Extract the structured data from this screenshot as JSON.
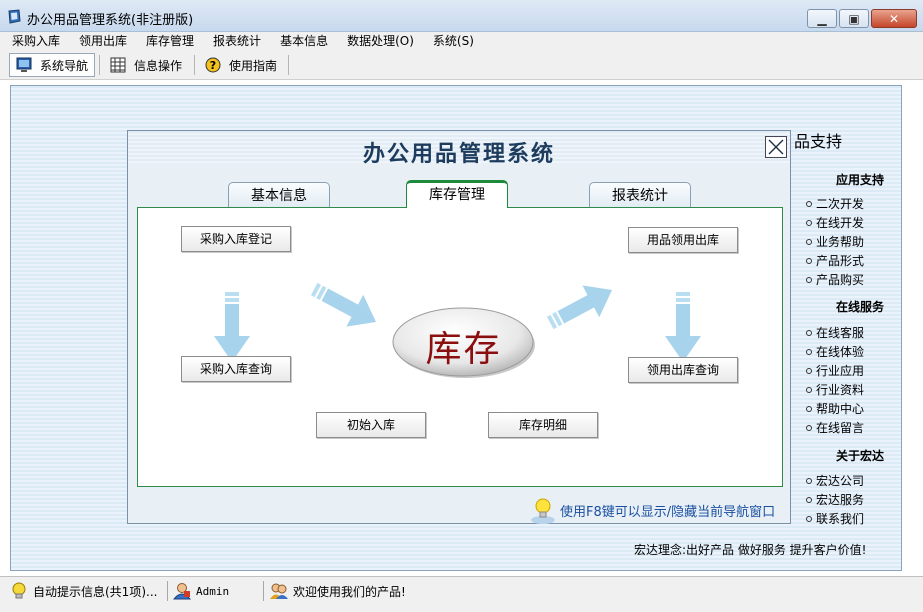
{
  "window": {
    "title": "办公用品管理系统(非注册版)"
  },
  "menu": [
    "采购入库",
    "领用出库",
    "库存管理",
    "报表统计",
    "基本信息",
    "数据处理(O)",
    "系统(S)"
  ],
  "toolbar": {
    "nav": "系统导航",
    "info_op": "信息操作",
    "guide": "使用指南"
  },
  "right_panel": {
    "title_partial": "品支持",
    "sections": [
      {
        "heading": "应用支持",
        "links": [
          "二次开发",
          "在线开发",
          "业务帮助",
          "产品形式",
          "产品购买"
        ]
      },
      {
        "heading": "在线服务",
        "links": [
          "在线客服",
          "在线体验",
          "行业应用",
          "行业资料",
          "帮助中心",
          "在线留言"
        ]
      },
      {
        "heading": "关于宏达",
        "links": [
          "宏达公司",
          "宏达服务",
          "联系我们"
        ]
      }
    ],
    "slogan": "宏达理念:出好产品 做好服务 提升客户价值!"
  },
  "dialog": {
    "title": "办公用品管理系统",
    "tabs": [
      "基本信息",
      "库存管理",
      "报表统计"
    ],
    "active_tab": "库存管理",
    "buttons": {
      "purchase_register": "采购入库登记",
      "purchase_query": "采购入库查询",
      "issue_out": "用品领用出库",
      "issue_query": "领用出库查询",
      "initial_stock": "初始入库",
      "stock_detail": "库存明细"
    },
    "center": "库存",
    "hint": "使用F8键可以显示/隐藏当前导航窗口"
  },
  "status": {
    "tips": "自动提示信息(共1项)...",
    "user": "Admin",
    "welcome": "欢迎使用我们的产品!"
  },
  "colors": {
    "accent_green": "#1e8a3c",
    "center_text": "#8b0f0f",
    "hint_text": "#1a4fa0",
    "arrow": "#9fd0ea"
  }
}
